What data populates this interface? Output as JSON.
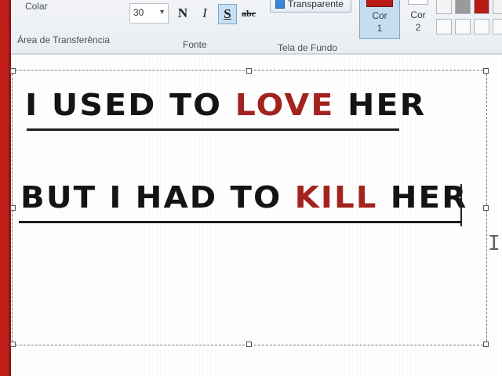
{
  "ribbon": {
    "paste_label": "Colar",
    "clipboard_group": "Área de Transferência",
    "font_group": "Fonte",
    "background_group": "Tela de Fundo",
    "font_size": "30",
    "bold": "N",
    "italic": "I",
    "underline": "S",
    "strikethrough": "abc",
    "transparent_label": "Transparente",
    "color1": {
      "label": "Cor",
      "number": "1",
      "color": "#b81b16"
    },
    "color2": {
      "label": "Cor",
      "number": "2",
      "color": "#ffffff"
    }
  },
  "canvas": {
    "line1": {
      "part1": "I USED TO ",
      "highlight": "LOVE",
      "part2": " HER"
    },
    "line2": {
      "part1": "BUT I HAD TO ",
      "highlight": "KILL",
      "part2": " HER"
    },
    "text_color": "#141414",
    "highlight_color": "#a3231e"
  }
}
